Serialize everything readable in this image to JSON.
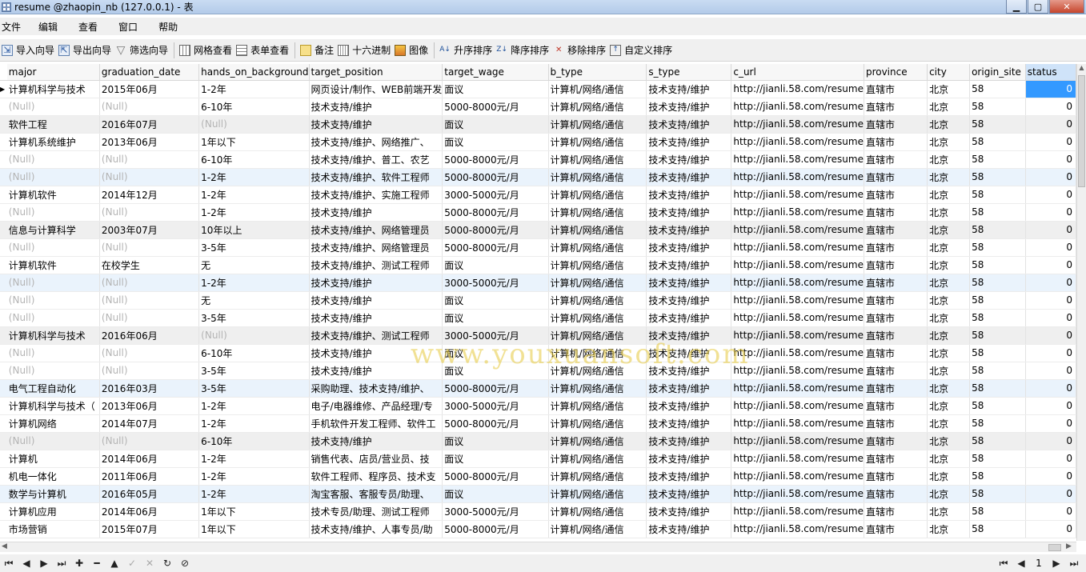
{
  "window": {
    "title": "resume @zhaopin_nb (127.0.0.1) - 表",
    "minimize": "▁",
    "maximize": "▢",
    "close": "✕"
  },
  "menu": [
    "文件",
    "编辑",
    "查看",
    "窗口",
    "帮助"
  ],
  "toolbar": {
    "import_wizard": "导入向导",
    "export_wizard": "导出向导",
    "filter_wizard": "筛选向导",
    "grid_view": "网格查看",
    "form_view": "表单查看",
    "memo": "备注",
    "hex": "十六进制",
    "image": "图像",
    "sort_asc": "升序排序",
    "sort_desc": "降序排序",
    "remove_sort": "移除排序",
    "custom_sort": "自定义排序"
  },
  "table": {
    "columns": [
      "major",
      "graduation_date",
      "hands_on_background",
      "target_position",
      "target_wage",
      "b_type",
      "s_type",
      "c_url",
      "province",
      "city",
      "origin_site",
      "status"
    ],
    "rows": [
      [
        "计算机科学与技术",
        "2015年06月",
        "1-2年",
        "网页设计/制作、WEB前端开发",
        "面议",
        "计算机/网络/通信",
        "技术支持/维护",
        "http://jianli.58.com/resume",
        "直辖市",
        "北京",
        "58",
        "0"
      ],
      [
        "(Null)",
        "(Null)",
        "6-10年",
        "技术支持/维护",
        "5000-8000元/月",
        "计算机/网络/通信",
        "技术支持/维护",
        "http://jianli.58.com/resume",
        "直辖市",
        "北京",
        "58",
        "0"
      ],
      [
        "软件工程",
        "2016年07月",
        "(Null)",
        "技术支持/维护",
        "面议",
        "计算机/网络/通信",
        "技术支持/维护",
        "http://jianli.58.com/resume",
        "直辖市",
        "北京",
        "58",
        "0"
      ],
      [
        "计算机系统维护",
        "2013年06月",
        "1年以下",
        "技术支持/维护、网络推广、",
        "面议",
        "计算机/网络/通信",
        "技术支持/维护",
        "http://jianli.58.com/resume",
        "直辖市",
        "北京",
        "58",
        "0"
      ],
      [
        "(Null)",
        "(Null)",
        "6-10年",
        "技术支持/维护、普工、农艺",
        "5000-8000元/月",
        "计算机/网络/通信",
        "技术支持/维护",
        "http://jianli.58.com/resume",
        "直辖市",
        "北京",
        "58",
        "0"
      ],
      [
        "(Null)",
        "(Null)",
        "1-2年",
        "技术支持/维护、软件工程师",
        "5000-8000元/月",
        "计算机/网络/通信",
        "技术支持/维护",
        "http://jianli.58.com/resume",
        "直辖市",
        "北京",
        "58",
        "0"
      ],
      [
        "计算机软件",
        "2014年12月",
        "1-2年",
        "技术支持/维护、实施工程师",
        "3000-5000元/月",
        "计算机/网络/通信",
        "技术支持/维护",
        "http://jianli.58.com/resume",
        "直辖市",
        "北京",
        "58",
        "0"
      ],
      [
        "(Null)",
        "(Null)",
        "1-2年",
        "技术支持/维护",
        "5000-8000元/月",
        "计算机/网络/通信",
        "技术支持/维护",
        "http://jianli.58.com/resume",
        "直辖市",
        "北京",
        "58",
        "0"
      ],
      [
        "信息与计算科学",
        "2003年07月",
        "10年以上",
        "技术支持/维护、网络管理员",
        "5000-8000元/月",
        "计算机/网络/通信",
        "技术支持/维护",
        "http://jianli.58.com/resume",
        "直辖市",
        "北京",
        "58",
        "0"
      ],
      [
        "(Null)",
        "(Null)",
        "3-5年",
        "技术支持/维护、网络管理员",
        "5000-8000元/月",
        "计算机/网络/通信",
        "技术支持/维护",
        "http://jianli.58.com/resume",
        "直辖市",
        "北京",
        "58",
        "0"
      ],
      [
        "计算机软件",
        "在校学生",
        "无",
        "技术支持/维护、测试工程师",
        "面议",
        "计算机/网络/通信",
        "技术支持/维护",
        "http://jianli.58.com/resume",
        "直辖市",
        "北京",
        "58",
        "0"
      ],
      [
        "(Null)",
        "(Null)",
        "1-2年",
        "技术支持/维护",
        "3000-5000元/月",
        "计算机/网络/通信",
        "技术支持/维护",
        "http://jianli.58.com/resume",
        "直辖市",
        "北京",
        "58",
        "0"
      ],
      [
        "(Null)",
        "(Null)",
        "无",
        "技术支持/维护",
        "面议",
        "计算机/网络/通信",
        "技术支持/维护",
        "http://jianli.58.com/resume",
        "直辖市",
        "北京",
        "58",
        "0"
      ],
      [
        "(Null)",
        "(Null)",
        "3-5年",
        "技术支持/维护",
        "面议",
        "计算机/网络/通信",
        "技术支持/维护",
        "http://jianli.58.com/resume",
        "直辖市",
        "北京",
        "58",
        "0"
      ],
      [
        "计算机科学与技术",
        "2016年06月",
        "(Null)",
        "技术支持/维护、测试工程师",
        "3000-5000元/月",
        "计算机/网络/通信",
        "技术支持/维护",
        "http://jianli.58.com/resume",
        "直辖市",
        "北京",
        "58",
        "0"
      ],
      [
        "(Null)",
        "(Null)",
        "6-10年",
        "技术支持/维护",
        "面议",
        "计算机/网络/通信",
        "技术支持/维护",
        "http://jianli.58.com/resume",
        "直辖市",
        "北京",
        "58",
        "0"
      ],
      [
        "(Null)",
        "(Null)",
        "3-5年",
        "技术支持/维护",
        "面议",
        "计算机/网络/通信",
        "技术支持/维护",
        "http://jianli.58.com/resume",
        "直辖市",
        "北京",
        "58",
        "0"
      ],
      [
        "电气工程自动化",
        "2016年03月",
        "3-5年",
        "采购助理、技术支持/维护、",
        "5000-8000元/月",
        "计算机/网络/通信",
        "技术支持/维护",
        "http://jianli.58.com/resume",
        "直辖市",
        "北京",
        "58",
        "0"
      ],
      [
        "计算机科学与技术（",
        "2013年06月",
        "1-2年",
        "电子/电器维修、产品经理/专",
        "3000-5000元/月",
        "计算机/网络/通信",
        "技术支持/维护",
        "http://jianli.58.com/resume",
        "直辖市",
        "北京",
        "58",
        "0"
      ],
      [
        "计算机网络",
        "2014年07月",
        "1-2年",
        "手机软件开发工程师、软件工",
        "5000-8000元/月",
        "计算机/网络/通信",
        "技术支持/维护",
        "http://jianli.58.com/resume",
        "直辖市",
        "北京",
        "58",
        "0"
      ],
      [
        "(Null)",
        "(Null)",
        "6-10年",
        "技术支持/维护",
        "面议",
        "计算机/网络/通信",
        "技术支持/维护",
        "http://jianli.58.com/resume",
        "直辖市",
        "北京",
        "58",
        "0"
      ],
      [
        "计算机",
        "2014年06月",
        "1-2年",
        "销售代表、店员/营业员、技",
        "面议",
        "计算机/网络/通信",
        "技术支持/维护",
        "http://jianli.58.com/resume",
        "直辖市",
        "北京",
        "58",
        "0"
      ],
      [
        "机电一体化",
        "2011年06月",
        "1-2年",
        "软件工程师、程序员、技术支",
        "5000-8000元/月",
        "计算机/网络/通信",
        "技术支持/维护",
        "http://jianli.58.com/resume",
        "直辖市",
        "北京",
        "58",
        "0"
      ],
      [
        "数学与计算机",
        "2016年05月",
        "1-2年",
        "淘宝客服、客服专员/助理、",
        "面议",
        "计算机/网络/通信",
        "技术支持/维护",
        "http://jianli.58.com/resume",
        "直辖市",
        "北京",
        "58",
        "0"
      ],
      [
        "计算机应用",
        "2014年06月",
        "1年以下",
        "技术专员/助理、测试工程师",
        "3000-5000元/月",
        "计算机/网络/通信",
        "技术支持/维护",
        "http://jianli.58.com/resume",
        "直辖市",
        "北京",
        "58",
        "0"
      ],
      [
        "市场营销",
        "2015年07月",
        "1年以下",
        "技术支持/维护、人事专员/助",
        "5000-8000元/月",
        "计算机/网络/通信",
        "技术支持/维护",
        "http://jianli.58.com/resume",
        "直辖市",
        "北京",
        "58",
        "0"
      ]
    ]
  },
  "watermark": "www.youxuansoft.com",
  "pager": {
    "page": "1"
  },
  "colors": {
    "selection": "#3399ff",
    "alt_row": "#eaf3fc",
    "null_text": "#b4b4b4"
  }
}
